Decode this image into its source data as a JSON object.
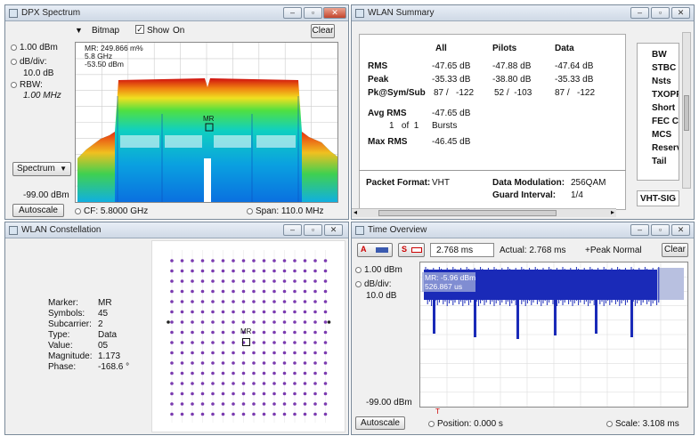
{
  "dpx": {
    "title": "DPX Spectrum",
    "mode": "Bitmap",
    "show_label": "Show",
    "on_label": "On",
    "clear": "Clear",
    "ref_level": "1.00 dBm",
    "db_div_label": "dB/div:",
    "db_div_value": "10.0 dB",
    "rbw_label": "RBW:",
    "rbw_value": "1.00 MHz",
    "marker_line1": "MR: 249.866 m%",
    "marker_line2": "5.8 GHz",
    "marker_line3": "-53.50 dBm",
    "marker_tag": "MR",
    "view_select": "Spectrum",
    "bottom_level": "-99.00 dBm",
    "autoscale": "Autoscale",
    "cf": "CF: 5.8000 GHz",
    "span": "Span: 110.0 MHz"
  },
  "wlan_summary": {
    "title": "WLAN Summary",
    "headers": [
      "All",
      "Pilots",
      "Data"
    ],
    "rows": [
      {
        "label": "RMS",
        "all": "-47.65 dB",
        "pilots": "-47.88 dB",
        "data": "-47.64 dB"
      },
      {
        "label": "Peak",
        "all": "-35.33 dB",
        "pilots": "-38.80 dB",
        "data": "-35.33 dB"
      },
      {
        "label": "Pk@Sym/Sub",
        "all": "87 /   -122",
        "pilots": "52 /  -103",
        "data": "87 /   -122"
      }
    ],
    "avg_rms_label": "Avg RMS",
    "avg_rms_value": "-47.65 dB",
    "bursts_text": "1   of  1",
    "bursts_label": "Bursts",
    "max_rms_label": "Max RMS",
    "max_rms_value": "-46.45 dB",
    "packet_format_label": "Packet Format:",
    "packet_format_value": "VHT",
    "data_mod_label": "Data Modulation:",
    "data_mod_value": "256QAM",
    "guard_label": "Guard Interval:",
    "guard_value": "1/4",
    "side_items": [
      "BW",
      "STBC",
      "Nsts",
      "TXOPP",
      "Short",
      "FEC Co",
      "MCS",
      "Reserv",
      "Tail"
    ],
    "side_bottom": "VHT-SIG"
  },
  "constellation": {
    "title": "WLAN Constellation",
    "labels": [
      "Marker:",
      "Symbols:",
      "Subcarrier:",
      "Type:",
      "Value:",
      "Magnitude:",
      "Phase:"
    ],
    "values": [
      "MR",
      "45",
      "2",
      "Data",
      "05",
      "1.173",
      "-168.6 °"
    ],
    "marker_tag": "MR",
    "grid_size": 16
  },
  "time": {
    "title": "Time Overview",
    "time_value": "2.768 ms",
    "actual": "Actual:  2.768 ms",
    "peak": "+Peak Normal",
    "clear": "Clear",
    "ref_level": "1.00 dBm",
    "db_div_label": "dB/div:",
    "db_div_value": "10.0 dB",
    "marker_line1": "MR: -5.96 dBm",
    "marker_line2": "526.867 us",
    "bottom_level": "-99.00 dBm",
    "autoscale": "Autoscale",
    "position": "Position:  0.000 s",
    "scale": "Scale:  3.108 ms",
    "trigger": "T"
  },
  "colors": {
    "trace": "#1a2ab8",
    "constellation": "#7a3ab0"
  }
}
